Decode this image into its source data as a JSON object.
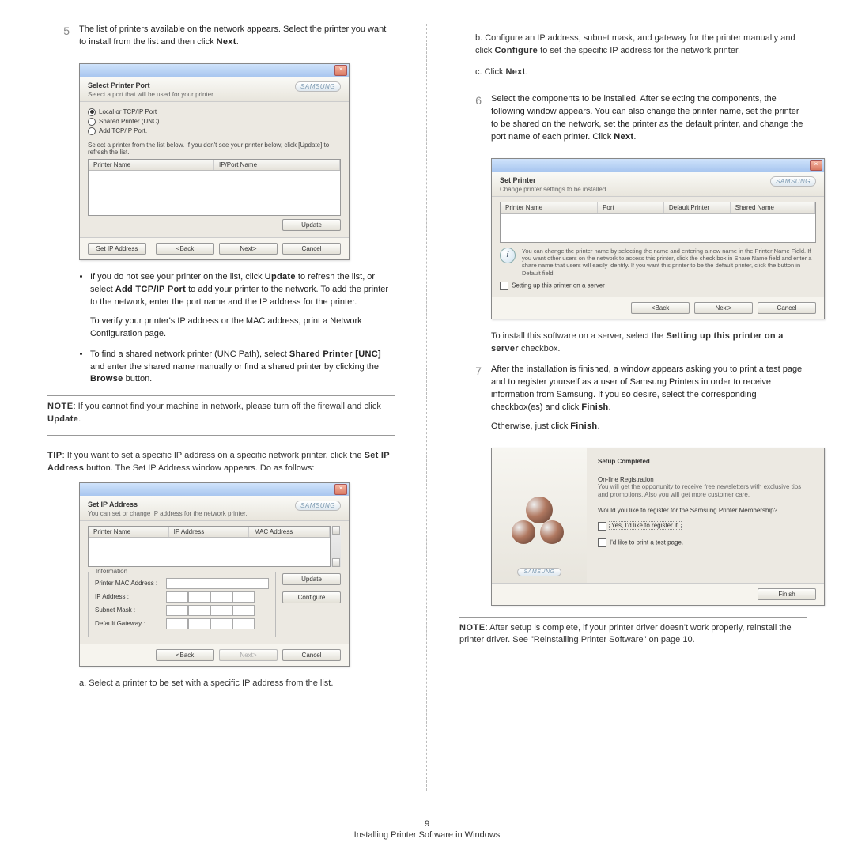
{
  "page_number": "9",
  "footer_title": "Installing Printer Software in Windows",
  "left": {
    "step5": {
      "num": "5",
      "text": "The list of printers available on the network appears. Select the printer you want to install from the list and then click ",
      "next": "Next",
      "dot": "."
    },
    "dlg1": {
      "title": "Select Printer Port",
      "subtitle": "Select a port that will be used for your printer.",
      "brand": "SAMSUNG",
      "r1": "Local or TCP/IP Port",
      "r2": "Shared Printer (UNC)",
      "r3": "Add TCP/IP Port.",
      "instr": "Select a printer from the list below. If you don't see your printer below, click [Update] to refresh the list.",
      "col1": "Printer Name",
      "col2": "IP/Port Name",
      "update": "Update",
      "setip": "Set IP Address",
      "back": "<Back",
      "nextb": "Next>",
      "cancel": "Cancel"
    },
    "bul1a": "If you do not see your printer on the list, click ",
    "bul1b": "Update",
    "bul1c": " to refresh the list, or select ",
    "bul1d": "Add TCP/IP Port",
    "bul1e": " to add your printer to the network. To add the printer to the network, enter the port name and the IP address for the printer.",
    "bul1p2": "To verify your printer's IP address or the MAC address, print a Network Configuration page.",
    "bul2a": "To find a shared network printer (UNC Path), select ",
    "bul2b": "Shared Printer [UNC]",
    "bul2c": " and enter the shared name manually or find a shared printer by clicking the ",
    "bul2d": "Browse",
    "bul2e": " button.",
    "note1a": "NOTE",
    "note1b": ": If you cannot find your machine in network, please turn off the firewall and click ",
    "note1c": "Update",
    "note1d": ".",
    "tip1a": "TIP",
    "tip1b": ": If you want to set a specific IP address on a specific network printer, click the ",
    "tip1c": "Set IP Address",
    "tip1d": " button. The Set IP Address window appears. Do as follows:",
    "dlg2": {
      "title": "Set IP Address",
      "subtitle": "You can set or change IP address for the network printer.",
      "brand": "SAMSUNG",
      "c1": "Printer Name",
      "c2": "IP Address",
      "c3": "MAC Address",
      "legend": "Information",
      "f1": "Printer MAC Address :",
      "f2": "IP Address :",
      "f3": "Subnet Mask :",
      "f4": "Default Gateway :",
      "update": "Update",
      "configure": "Configure",
      "back": "<Back",
      "next": "Next>",
      "cancel": "Cancel"
    },
    "a1": "a. Select a printer to be set with a specific IP address from the list."
  },
  "right": {
    "b1a": "b. Configure an IP address, subnet mask, and gateway for the printer manually and click ",
    "b1b": "Configure",
    "b1c": " to set the specific IP address for the network printer.",
    "c1a": "c. Click ",
    "c1b": "Next",
    "c1c": ".",
    "step6": {
      "num": "6",
      "text": "Select the components to be installed. After selecting the components, the following window appears. You can also change the printer name, set the printer to be shared on the network, set the printer as the default printer, and change the port name of each printer. Click ",
      "next": "Next",
      "dot": "."
    },
    "dlg3": {
      "title": "Set Printer",
      "subtitle": "Change printer settings to be installed.",
      "brand": "SAMSUNG",
      "c1": "Printer Name",
      "c2": "Port",
      "c3": "Default Printer",
      "c4": "Shared Name",
      "info": "You can change the printer name by selecting the name and entering a new name in the Printer Name Field. If you want other users on the network to access this printer, click the check box in Share Name field and enter a share name that users will easily identify. If you want this printer to be the default printer, click the button in Default field.",
      "chk": "Setting up this printer on a server",
      "back": "<Back",
      "next": "Next>",
      "cancel": "Cancel"
    },
    "p_after3a": "To install this software on a server, select the ",
    "p_after3b": "Setting up this printer on a server",
    "p_after3c": " checkbox.",
    "step7": {
      "num": "7",
      "t1": "After the installation is finished, a window appears asking you to print a test page and to register yourself as a user of Samsung Printers in order to receive information from Samsung. If you so desire, select the corresponding checkbox(es) and click ",
      "t1b": "Finish",
      "t1c": ".",
      "t2": "Otherwise, just click ",
      "t2b": "Finish",
      "t2c": "."
    },
    "dlg4": {
      "title": "Setup Completed",
      "reg_h": "On-line Registration",
      "reg_t": "You will get the opportunity to receive free newsletters with exclusive tips and promotions. Also you will get more customer care.",
      "q": "Would you like to register for the Samsung Printer Membership?",
      "chk1": "Yes, I'd like to register it.",
      "chk2": "I'd like to print a test page.",
      "brand": "SAMSUNG",
      "finish": "Finish"
    },
    "note2a": "NOTE",
    "note2b": ": After setup is complete, if your printer driver doesn't work properly, reinstall the printer driver. See \"Reinstalling Printer Software\" on page 10."
  }
}
